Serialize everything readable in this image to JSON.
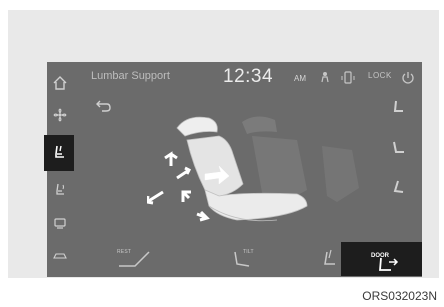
{
  "header": {
    "title": "Lumbar Support",
    "time": "12:34",
    "ampm": "AM",
    "lock_label": "LOCK"
  },
  "sidebar": {
    "items": [
      {
        "icon": "home-icon"
      },
      {
        "icon": "fan-icon"
      },
      {
        "icon": "seat-lumbar-icon",
        "active": true
      },
      {
        "icon": "seat-heat-icon"
      },
      {
        "icon": "climate-vent-icon"
      },
      {
        "icon": "car-icon"
      }
    ]
  },
  "bottom_bar": {
    "buttons": [
      {
        "label": "REST"
      },
      {
        "label": "TILT"
      },
      {
        "label": ""
      },
      {
        "label": "DOOR",
        "active": true
      }
    ]
  },
  "caption": "ORS032023N",
  "colors": {
    "screen_bg": "#6b6b6b",
    "active_bg": "#1d1d1d",
    "frame_bg": "#e9e9e9"
  }
}
